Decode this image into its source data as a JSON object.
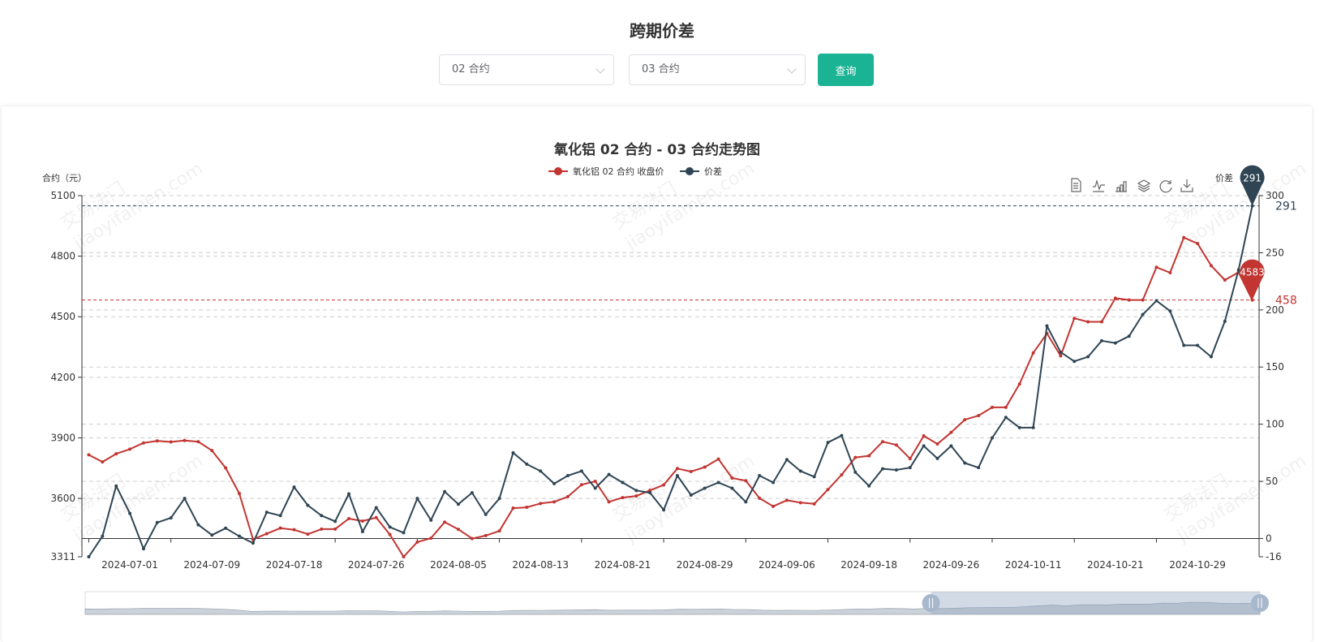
{
  "header": {
    "title": "跨期价差",
    "select1": "02 合约",
    "select2": "03 合约",
    "query_label": "查询"
  },
  "watermark": {
    "line1": "交易法门",
    "line2": "jiaoyifamen.com"
  },
  "toolbox": [
    "data-view-icon",
    "line-chart-icon",
    "bar-chart-icon",
    "stack-icon",
    "restore-icon",
    "save-image-icon"
  ],
  "colors": {
    "close": "#c23531",
    "spread": "#2f4554",
    "button": "#1ab394"
  },
  "chart_data": {
    "type": "line",
    "title": "氧化铝 02 合约 - 03 合约走势图",
    "legend_position": "top-center",
    "grid": true,
    "x_tick_labels": [
      "2024-07-01",
      "2024-07-09",
      "2024-07-18",
      "2024-07-26",
      "2024-08-05",
      "2024-08-13",
      "2024-08-21",
      "2024-08-29",
      "2024-09-06",
      "2024-09-18",
      "2024-09-26",
      "2024-10-11",
      "2024-10-21",
      "2024-10-29"
    ],
    "x_tick_label_start_index": 3,
    "x_tick_label_interval": 6,
    "point_count": 86,
    "y_left": {
      "name": "合约（元）",
      "min": 3311,
      "max": 5100,
      "ticks": [
        "5100",
        "4800",
        "4500",
        "4200",
        "3900",
        "3600",
        "3311"
      ]
    },
    "y_right": {
      "name": "价差",
      "min": -16,
      "max": 300,
      "ticks": [
        "300",
        "250",
        "200",
        "150",
        "100",
        "50",
        "0",
        "-16"
      ]
    },
    "series": [
      {
        "name": "氧化铝 02 合约 收盘价",
        "axis": "left",
        "color": "#c23531",
        "values": [
          3816,
          3781,
          3821,
          3844,
          3875,
          3885,
          3880,
          3887,
          3881,
          3837,
          3751,
          3624,
          3397,
          3425,
          3453,
          3445,
          3423,
          3448,
          3448,
          3500,
          3488,
          3505,
          3421,
          3311,
          3384,
          3403,
          3483,
          3447,
          3401,
          3416,
          3439,
          3552,
          3556,
          3575,
          3583,
          3609,
          3668,
          3685,
          3583,
          3604,
          3612,
          3640,
          3667,
          3748,
          3733,
          3755,
          3795,
          3701,
          3688,
          3601,
          3561,
          3591,
          3579,
          3573,
          3644,
          3717,
          3803,
          3811,
          3881,
          3865,
          3797,
          3910,
          3870,
          3927,
          3990,
          4010,
          4051,
          4051,
          4167,
          4321,
          4417,
          4306,
          4492,
          4475,
          4475,
          4592,
          4583,
          4583,
          4745,
          4718,
          4892,
          4863,
          4753,
          4682,
          4720,
          4583
        ],
        "mark_line": {
          "value": 4583,
          "label": "458"
        },
        "mark_point": {
          "label": "4583"
        }
      },
      {
        "name": "价差",
        "axis": "right",
        "color": "#2f4554",
        "values": [
          -16,
          2,
          46,
          22,
          -9,
          14,
          18,
          35,
          12,
          3,
          9,
          2,
          -4,
          23,
          20,
          45,
          29,
          20,
          15,
          39,
          6,
          27,
          10,
          5,
          35,
          16,
          41,
          30,
          40,
          21,
          35,
          75,
          65,
          59,
          48,
          55,
          59,
          44,
          56,
          49,
          42,
          40,
          25,
          55,
          38,
          44,
          49,
          44,
          32,
          55,
          49,
          69,
          59,
          54,
          84,
          90,
          58,
          46,
          61,
          60,
          62,
          81,
          70,
          81,
          66,
          62,
          88,
          106,
          97,
          97,
          186,
          163,
          155,
          159,
          173,
          171,
          177,
          196,
          208,
          199,
          169,
          169,
          159,
          190,
          235,
          291
        ],
        "mark_line": {
          "value": 291,
          "label": "291"
        },
        "mark_point": {
          "label": "291"
        }
      }
    ],
    "data_zoom": {
      "start_percent": 72,
      "end_percent": 100
    }
  }
}
